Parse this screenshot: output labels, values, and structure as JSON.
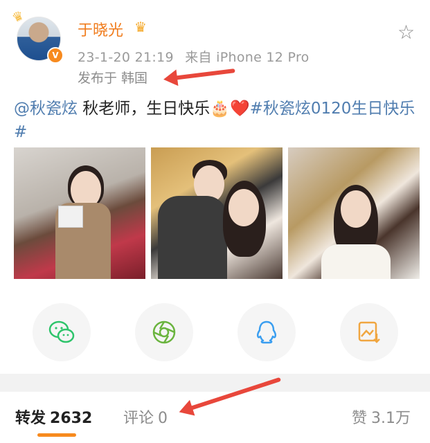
{
  "author": {
    "name": "于晓光",
    "verified_badge": "V",
    "avatar_crown_icon": "crown-icon",
    "vip_icon": "vip-crown-icon"
  },
  "meta": {
    "datetime": "23-1-20 21:19",
    "source": "来自 iPhone 12 Pro",
    "location": "发布于 韩国"
  },
  "post": {
    "mention": "@秋瓷炫",
    "text": " 秋老师，生日快乐🎂❤️",
    "hashtag": "#秋瓷炫0120生日快乐#"
  },
  "photos": [
    {
      "name": "photo-1"
    },
    {
      "name": "photo-2"
    },
    {
      "name": "photo-3"
    }
  ],
  "share": [
    {
      "icon": "wechat-icon",
      "color": "#2ec46b"
    },
    {
      "icon": "moments-icon",
      "color": "#6ab43e"
    },
    {
      "icon": "qq-icon",
      "color": "#3a9ef0"
    },
    {
      "icon": "save-image-icon",
      "color": "#f0a640"
    }
  ],
  "tabs": {
    "repost_label": "转发",
    "repost_count": "2632",
    "comment_label": "评论",
    "comment_count": "0",
    "like_label": "赞",
    "like_count": "3.1万"
  },
  "colors": {
    "accent": "#f78a1e",
    "link": "#507daf",
    "annotation_arrow": "#e8473b"
  }
}
